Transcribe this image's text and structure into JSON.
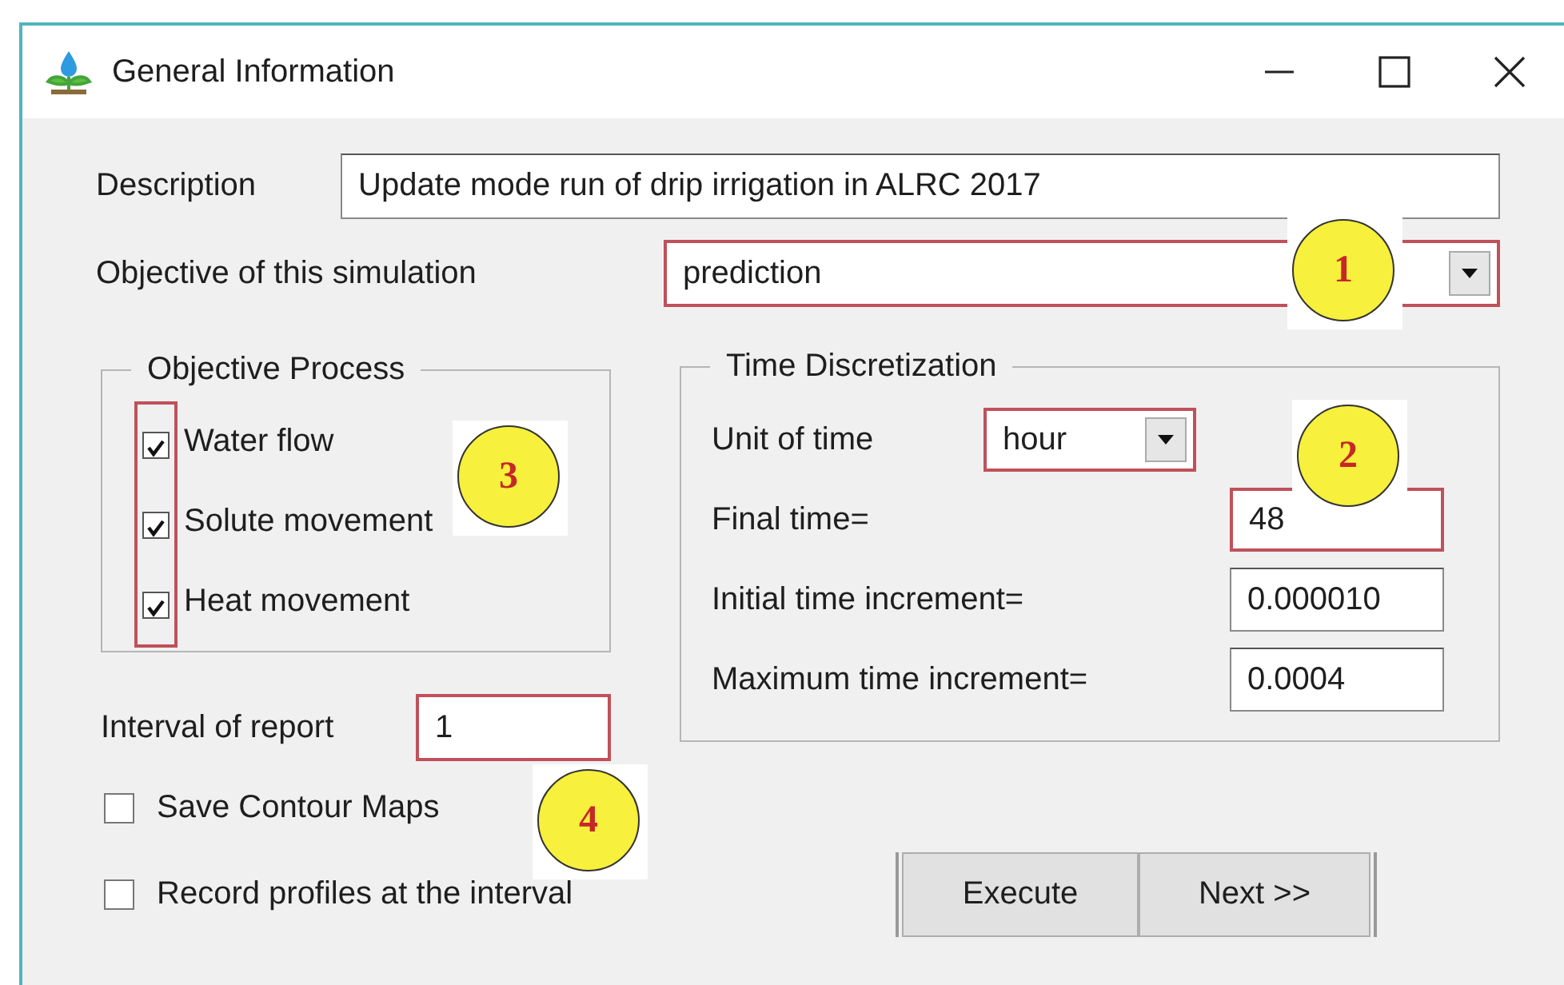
{
  "window": {
    "title": "General Information"
  },
  "description": {
    "label": "Description",
    "value": "Update mode run of drip irrigation in ALRC 2017"
  },
  "objective": {
    "label": "Objective of this simulation",
    "value": "prediction",
    "highlighted": true,
    "callout": "1"
  },
  "objective_process": {
    "title": "Objective Process",
    "highlighted": true,
    "callout": "3",
    "items": [
      {
        "label": "Water flow",
        "checked": true
      },
      {
        "label": "Solute movement",
        "checked": true
      },
      {
        "label": "Heat movement",
        "checked": true
      }
    ]
  },
  "time_discretization": {
    "title": "Time Discretization",
    "callout": "2",
    "unit": {
      "label": "Unit of time",
      "value": "hour",
      "highlighted": true
    },
    "fields": [
      {
        "label": "Final time=",
        "value": "48",
        "highlighted": true
      },
      {
        "label": "Initial time increment=",
        "value": "0.000010",
        "highlighted": false
      },
      {
        "label": "Maximum time increment=",
        "value": "0.0004",
        "highlighted": false
      }
    ]
  },
  "interval": {
    "label": "Interval of report",
    "value": "1",
    "highlighted": true,
    "callout": "4"
  },
  "options": [
    {
      "label": "Save Contour Maps",
      "checked": false
    },
    {
      "label": "Record profiles at the interval",
      "checked": false
    }
  ],
  "buttons": [
    "Execute",
    "Next >>"
  ]
}
